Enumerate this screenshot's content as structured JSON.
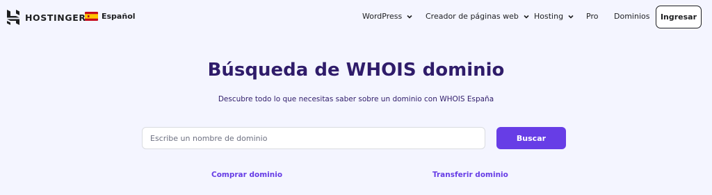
{
  "header": {
    "brand": "HOSTINGER",
    "language": {
      "label": "Español",
      "flag": "spain-flag-icon"
    },
    "nav": [
      {
        "label": "WordPress",
        "has_dropdown": true
      },
      {
        "label": "Creador de páginas web",
        "has_dropdown": true
      },
      {
        "label": "Hosting",
        "has_dropdown": true
      },
      {
        "label": "Pro",
        "has_dropdown": false
      },
      {
        "label": "Dominios",
        "has_dropdown": false
      }
    ],
    "login_label": "Ingresar"
  },
  "hero": {
    "title": "Búsqueda de WHOIS dominio",
    "subtitle": "Descubre todo lo que necesitas saber sobre un dominio con WHOIS España"
  },
  "search": {
    "placeholder": "Escribe un nombre de dominio",
    "value": "",
    "button_label": "Buscar"
  },
  "links": {
    "buy": "Comprar dominio",
    "transfer": "Transferir dominio"
  },
  "colors": {
    "background": "#f4f5ff",
    "heading": "#2f1c6a",
    "accent": "#673de6",
    "text_dark": "#1d1e20"
  }
}
